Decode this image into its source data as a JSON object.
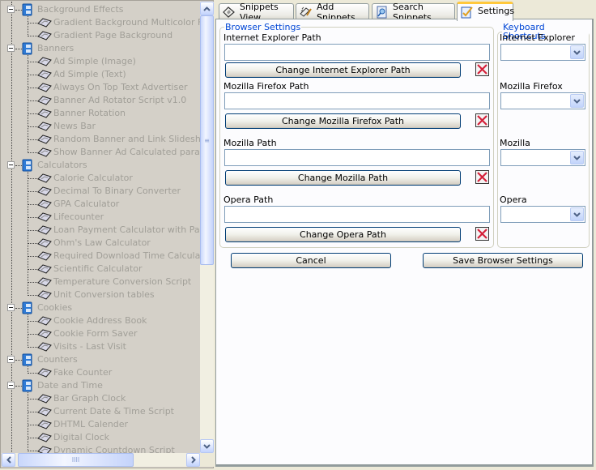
{
  "tree": {
    "categories": [
      {
        "label": "Background Effects",
        "items": [
          "Gradient Background Multicolor Fader",
          "Gradient Page  Background"
        ]
      },
      {
        "label": "Banners",
        "items": [
          "Ad Simple (Image)",
          "Ad Simple (Text)",
          "Always On Top Text Advertiser",
          "Banner Ad Rotator Script v1.0",
          "Banner Rotation",
          "News Bar",
          "Random Banner and Link Slideshow",
          "Show Banner Ad Calculated paramter"
        ]
      },
      {
        "label": "Calculators",
        "items": [
          "Calorie Calculator",
          "Decimal To Binary Converter",
          "GPA Calculator",
          "Lifecounter",
          "Loan Payment Calculator with Paymer",
          "Ohm's Law Calculator",
          "Required Download Time Calculator",
          "Scientific Calculator",
          "Temperature Conversion Script",
          "Unit Conversion tables"
        ]
      },
      {
        "label": "Cookies",
        "items": [
          "Cookie Address Book",
          "Cookie Form Saver",
          "Visits - Last Visit"
        ]
      },
      {
        "label": "Counters",
        "items": [
          "Fake Counter"
        ]
      },
      {
        "label": "Date and Time",
        "items": [
          "Bar Graph Clock",
          "Current Date & Time Script",
          "DHTML Calender",
          "Digital Clock",
          "Dynamic Countdown Script"
        ]
      }
    ],
    "hscroll_grip": "IIII",
    "vscroll_grip": "≡"
  },
  "tabs": [
    {
      "label": "Snippets View",
      "icon": "snippets-view-icon"
    },
    {
      "label": "Add Snippets",
      "icon": "add-snippets-icon"
    },
    {
      "label": "Search Snippets",
      "icon": "search-snippets-icon"
    },
    {
      "label": "Settings",
      "icon": "settings-icon",
      "active": true
    }
  ],
  "browser_settings": {
    "legend": "Browser Settings",
    "browsers": [
      {
        "key": "ie",
        "path_label": "Internet Explorer Path",
        "path_value": "",
        "change_label": "Change Internet Explorer Path"
      },
      {
        "key": "firefox",
        "path_label": "Mozilla Firefox Path",
        "path_value": "",
        "change_label": "Change Mozilla Firefox Path"
      },
      {
        "key": "mozilla",
        "path_label": "Mozilla Path",
        "path_value": "",
        "change_label": "Change Mozilla Path"
      },
      {
        "key": "opera",
        "path_label": "Opera Path",
        "path_value": "",
        "change_label": "Change Opera Path"
      }
    ]
  },
  "keyboard_shortcuts": {
    "legend": "Keyboard Shortcuts",
    "items": [
      {
        "label": "Internet Explorer",
        "selected": ""
      },
      {
        "label": "Mozilla Firefox",
        "selected": ""
      },
      {
        "label": "Mozilla",
        "selected": ""
      },
      {
        "label": "Opera",
        "selected": ""
      }
    ]
  },
  "actions": {
    "cancel_label": "Cancel",
    "save_label": "Save Browser Settings"
  },
  "colors": {
    "legend_blue": "#0046D5",
    "active_tab_accent": "#FFC83C",
    "delete_red": "#D4213A",
    "disabled_text": "#A19F98"
  }
}
